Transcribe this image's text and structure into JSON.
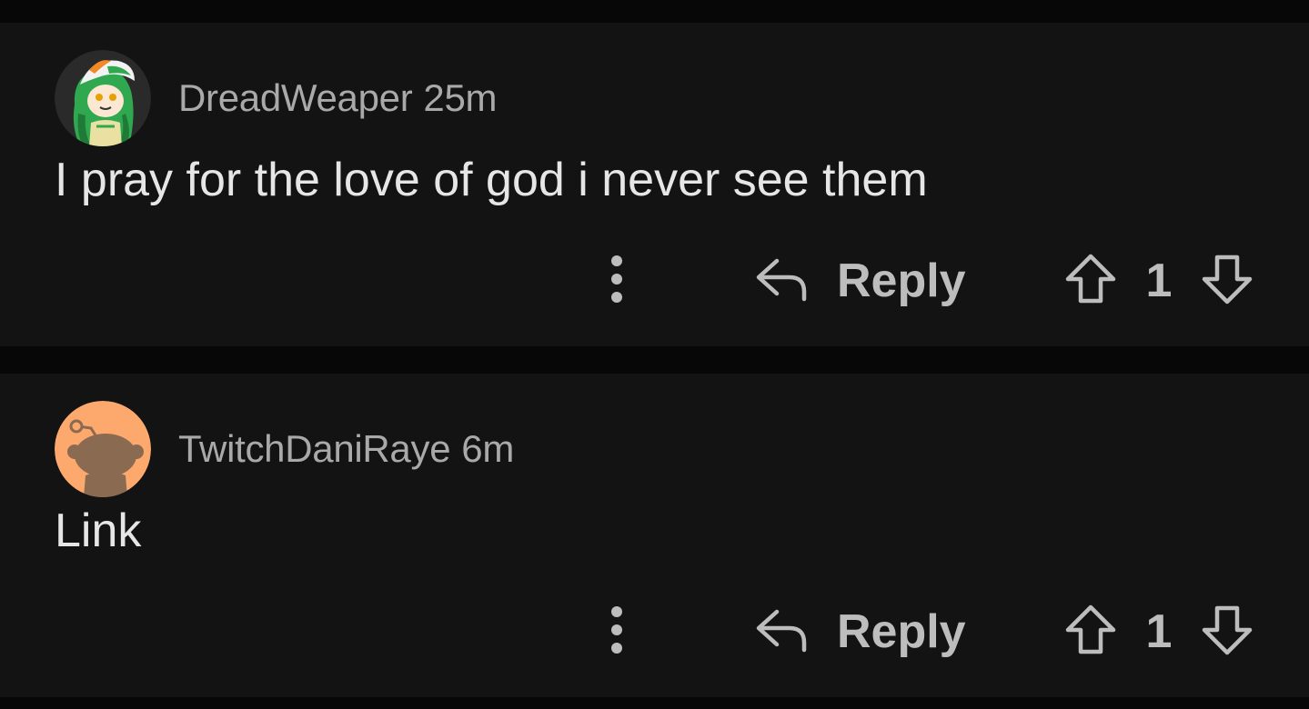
{
  "comments": [
    {
      "username": "DreadWeaper",
      "time": "25m",
      "body": "I pray for the love of god i never see them",
      "avatar_icon": "anime-character-avatar",
      "reply_label": "Reply",
      "score": "1"
    },
    {
      "username": "TwitchDaniRaye",
      "time": "6m",
      "body": "Link",
      "avatar_icon": "snoo-default-avatar",
      "reply_label": "Reply",
      "score": "1"
    }
  ],
  "colors": {
    "background": "#070707",
    "card": "#131313",
    "meta_text": "#a9a9a9",
    "body_text": "#e6e6e6",
    "action_text": "#bdbdbd",
    "avatar_orange": "#fda96e"
  }
}
